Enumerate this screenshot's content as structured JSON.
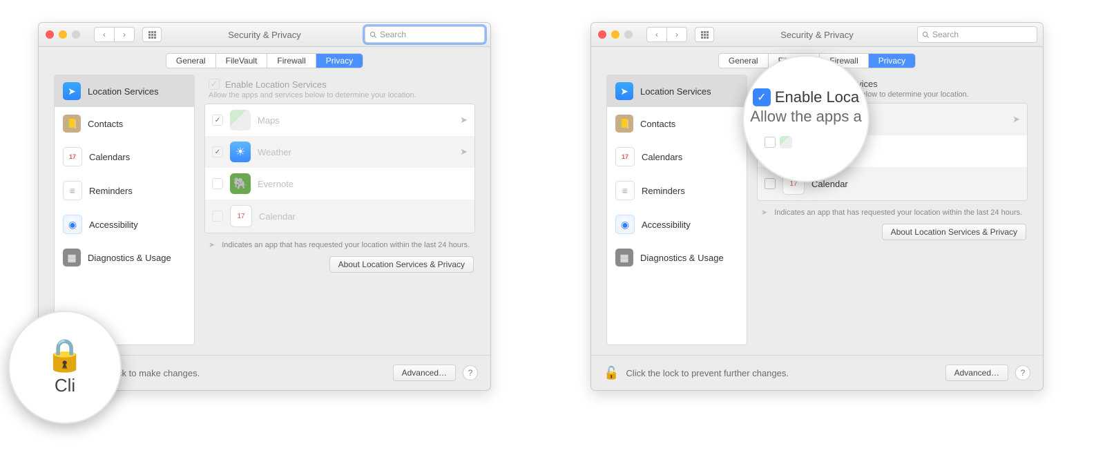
{
  "window_title": "Security & Privacy",
  "search_placeholder": "Search",
  "tabs": {
    "general": "General",
    "filevault": "FileVault",
    "firewall": "Firewall",
    "privacy": "Privacy"
  },
  "sidebar": {
    "location": "Location Services",
    "contacts": "Contacts",
    "calendars": "Calendars",
    "reminders": "Reminders",
    "accessibility": "Accessibility",
    "diagnostics": "Diagnostics & Usage"
  },
  "enable_label": "Enable Location Services",
  "enable_sub": "Allow the apps and services below to determine your location.",
  "apps": {
    "maps": "Maps",
    "weather": "Weather",
    "evernote": "Evernote",
    "calendar": "Calendar"
  },
  "legend": "Indicates an app that has requested your location within the last 24 hours.",
  "about_btn": "About Location Services & Privacy",
  "advanced_btn": "Advanced…",
  "footer_locked": "Click the lock to make changes.",
  "footer_unlocked": "Click the lock to prevent further changes.",
  "cal_num": "17",
  "help": "?",
  "mag1_text": "Cli",
  "mag2_line1": "Enable Loca",
  "mag2_line2": "Allow the apps a"
}
